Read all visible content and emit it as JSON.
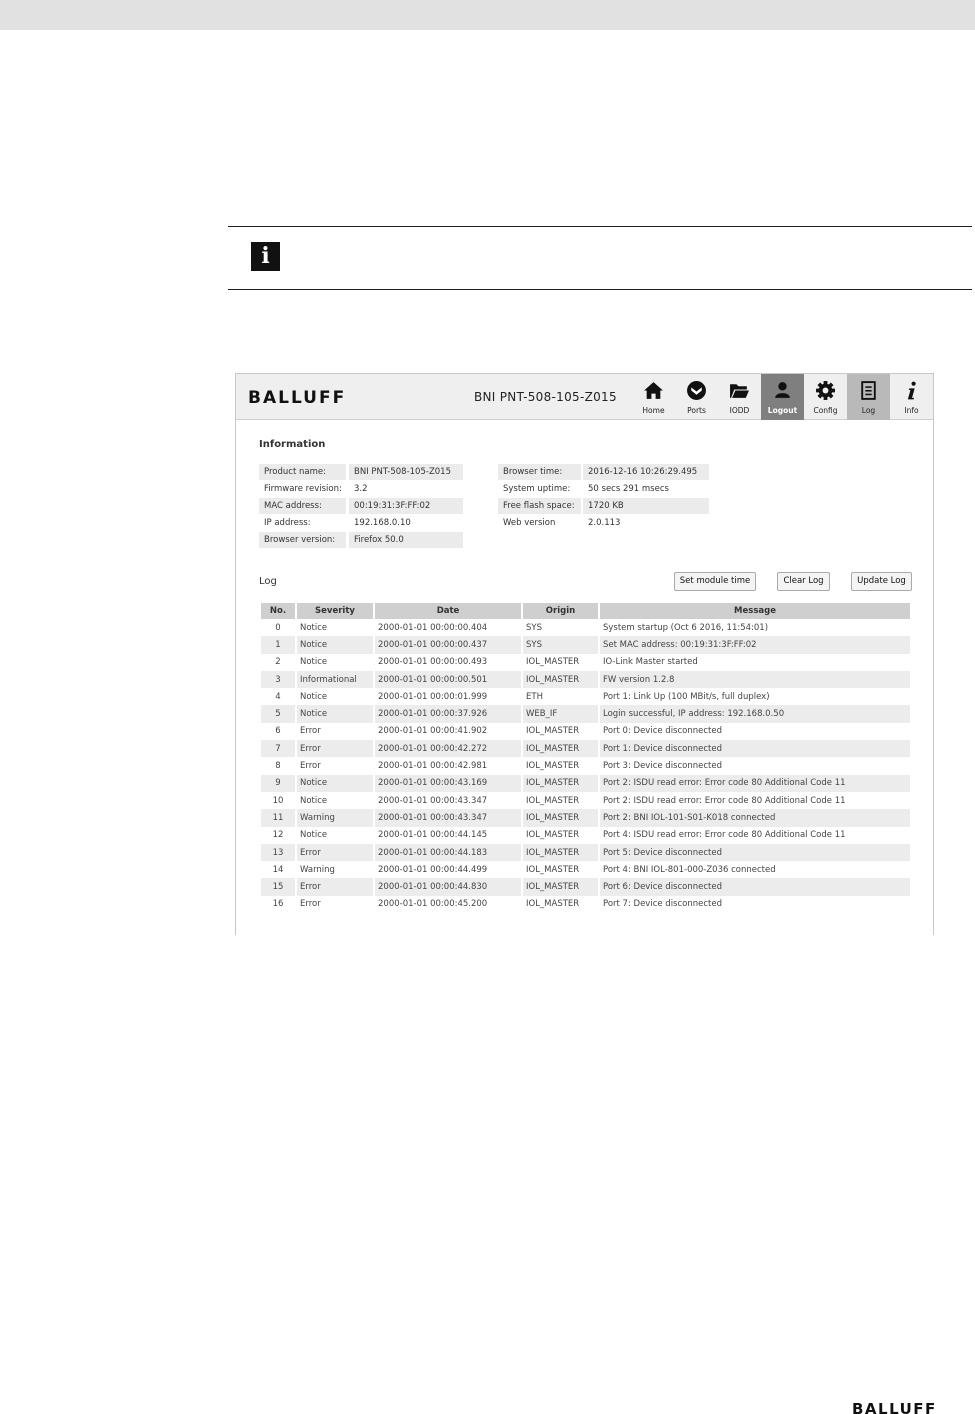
{
  "note": {
    "icon": "info-icon"
  },
  "app": {
    "brand": "BALLUFF",
    "device_name": "BNI PNT-508-105-Z015",
    "nav": [
      {
        "label": "Home",
        "icon": "home-icon"
      },
      {
        "label": "Ports",
        "icon": "ports-icon"
      },
      {
        "label": "IODD",
        "icon": "folder-icon"
      },
      {
        "label": "Logout",
        "icon": "user-icon"
      },
      {
        "label": "Config",
        "icon": "gear-icon"
      },
      {
        "label": "Log",
        "icon": "document-icon"
      },
      {
        "label": "Info",
        "icon": "info-icon"
      }
    ]
  },
  "information": {
    "title": "Information",
    "left": [
      {
        "label": "Product name:",
        "value": "BNI PNT-508-105-Z015"
      },
      {
        "label": "Firmware revision:",
        "value": "3.2"
      },
      {
        "label": "MAC address:",
        "value": "00:19:31:3F:FF:02"
      },
      {
        "label": "IP address:",
        "value": "192.168.0.10"
      },
      {
        "label": "Browser version:",
        "value": "Firefox 50.0"
      }
    ],
    "right": [
      {
        "label": "Browser time:",
        "value": "2016-12-16 10:26:29.495"
      },
      {
        "label": "System uptime:",
        "value": "50 secs 291 msecs"
      },
      {
        "label": "Free flash space:",
        "value": "1720 KB"
      },
      {
        "label": "Web version",
        "value": "2.0.113"
      }
    ]
  },
  "log": {
    "title": "Log",
    "buttons": {
      "set_time": "Set module time",
      "clear": "Clear Log",
      "update": "Update Log"
    },
    "columns": [
      "No.",
      "Severity",
      "Date",
      "Origin",
      "Message"
    ],
    "rows": [
      {
        "no": "0",
        "severity": "Notice",
        "date": "2000-01-01 00:00:00.404",
        "origin": "SYS",
        "message": "System startup (Oct 6 2016, 11:54:01)"
      },
      {
        "no": "1",
        "severity": "Notice",
        "date": "2000-01-01 00:00:00.437",
        "origin": "SYS",
        "message": "Set MAC address: 00:19:31:3F:FF:02"
      },
      {
        "no": "2",
        "severity": "Notice",
        "date": "2000-01-01 00:00:00.493",
        "origin": "IOL_MASTER",
        "message": "IO-Link Master started"
      },
      {
        "no": "3",
        "severity": "Informational",
        "date": "2000-01-01 00:00:00.501",
        "origin": "IOL_MASTER",
        "message": "FW version 1.2.8"
      },
      {
        "no": "4",
        "severity": "Notice",
        "date": "2000-01-01 00:00:01.999",
        "origin": "ETH",
        "message": "Port 1: Link Up (100 MBit/s, full duplex)"
      },
      {
        "no": "5",
        "severity": "Notice",
        "date": "2000-01-01 00:00:37.926",
        "origin": "WEB_IF",
        "message": "Login successful, IP address: 192.168.0.50"
      },
      {
        "no": "6",
        "severity": "Error",
        "date": "2000-01-01 00:00:41.902",
        "origin": "IOL_MASTER",
        "message": "Port 0: Device disconnected"
      },
      {
        "no": "7",
        "severity": "Error",
        "date": "2000-01-01 00:00:42.272",
        "origin": "IOL_MASTER",
        "message": "Port 1: Device disconnected"
      },
      {
        "no": "8",
        "severity": "Error",
        "date": "2000-01-01 00:00:42.981",
        "origin": "IOL_MASTER",
        "message": "Port 3: Device disconnected"
      },
      {
        "no": "9",
        "severity": "Notice",
        "date": "2000-01-01 00:00:43.169",
        "origin": "IOL_MASTER",
        "message": "Port 2: ISDU read error: Error code 80 Additional Code 11"
      },
      {
        "no": "10",
        "severity": "Notice",
        "date": "2000-01-01 00:00:43.347",
        "origin": "IOL_MASTER",
        "message": "Port 2: ISDU read error: Error code 80 Additional Code 11"
      },
      {
        "no": "11",
        "severity": "Warning",
        "date": "2000-01-01 00:00:43.347",
        "origin": "IOL_MASTER",
        "message": "Port 2: BNI IOL-101-S01-K018 connected"
      },
      {
        "no": "12",
        "severity": "Notice",
        "date": "2000-01-01 00:00:44.145",
        "origin": "IOL_MASTER",
        "message": "Port 4: ISDU read error: Error code 80 Additional Code 11"
      },
      {
        "no": "13",
        "severity": "Error",
        "date": "2000-01-01 00:00:44.183",
        "origin": "IOL_MASTER",
        "message": "Port 5: Device disconnected"
      },
      {
        "no": "14",
        "severity": "Warning",
        "date": "2000-01-01 00:00:44.499",
        "origin": "IOL_MASTER",
        "message": "Port 4: BNI IOL-801-000-Z036 connected"
      },
      {
        "no": "15",
        "severity": "Error",
        "date": "2000-01-01 00:00:44.830",
        "origin": "IOL_MASTER",
        "message": "Port 6: Device disconnected"
      },
      {
        "no": "16",
        "severity": "Error",
        "date": "2000-01-01 00:00:45.200",
        "origin": "IOL_MASTER",
        "message": "Port 7: Device disconnected"
      }
    ]
  },
  "footer": {
    "brand": "BALLUFF"
  }
}
